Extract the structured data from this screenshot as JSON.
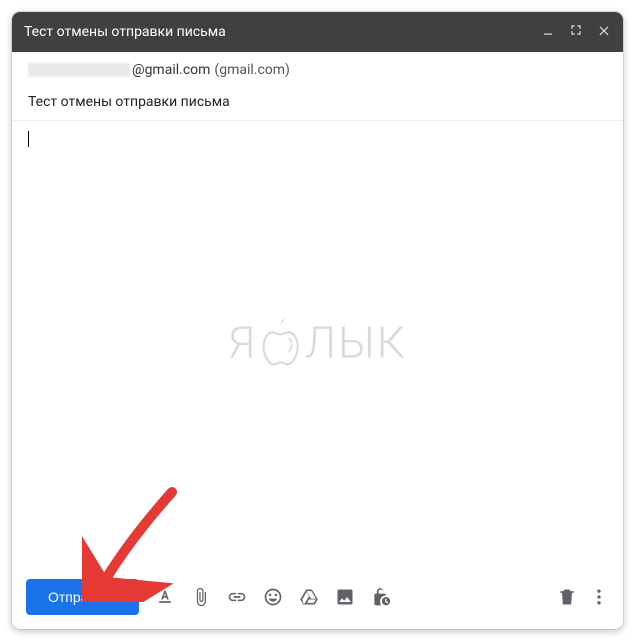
{
  "header": {
    "title": "Тест отмены отправки письма"
  },
  "recipient": {
    "domain": "@gmail.com",
    "hint": "(gmail.com)"
  },
  "subject": "Тест отмены отправки письма",
  "body": "",
  "watermark": {
    "left": "Я",
    "right": "ЛЫК"
  },
  "toolbar": {
    "send_label": "Отправить"
  },
  "icons": {
    "minimize": "minimize",
    "expand": "expand",
    "close": "close",
    "format": "text-format",
    "attach": "attachment",
    "link": "link",
    "emoji": "emoji",
    "drive": "drive",
    "image": "image",
    "confidential": "lock-clock",
    "trash": "trash",
    "more": "more-vert"
  }
}
